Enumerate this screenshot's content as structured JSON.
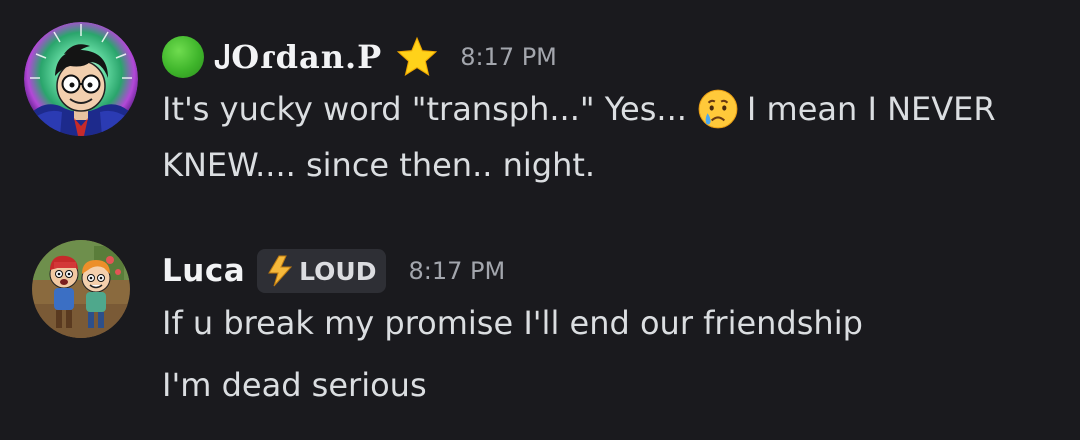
{
  "messages": [
    {
      "username": "ᎫOɾdan.P",
      "timestamp": "8:17 PM",
      "status": "online",
      "badge_icon": "star-icon",
      "lines": [
        {
          "before_emoji": "It's yucky word \"transph...\" Yes...",
          "emoji": "crying-face-icon",
          "after_emoji": "I mean I NEVER"
        },
        {
          "text": "KNEW.... since then.. night."
        }
      ]
    },
    {
      "username": "Luca",
      "tag": {
        "icon": "lightning-bolt-icon",
        "label": "LOUD"
      },
      "timestamp": "8:17 PM",
      "lines": [
        {
          "text": "If u break my promise I'll end our friendship"
        },
        {
          "text": "I'm dead serious"
        }
      ]
    }
  ],
  "colors": {
    "background": "#1a1a1e",
    "text": "#dbdee1",
    "username": "#f2f3f5",
    "timestamp": "#a3a6ad",
    "online": "#3fb52b",
    "tag_bg": "#2e2f35"
  }
}
